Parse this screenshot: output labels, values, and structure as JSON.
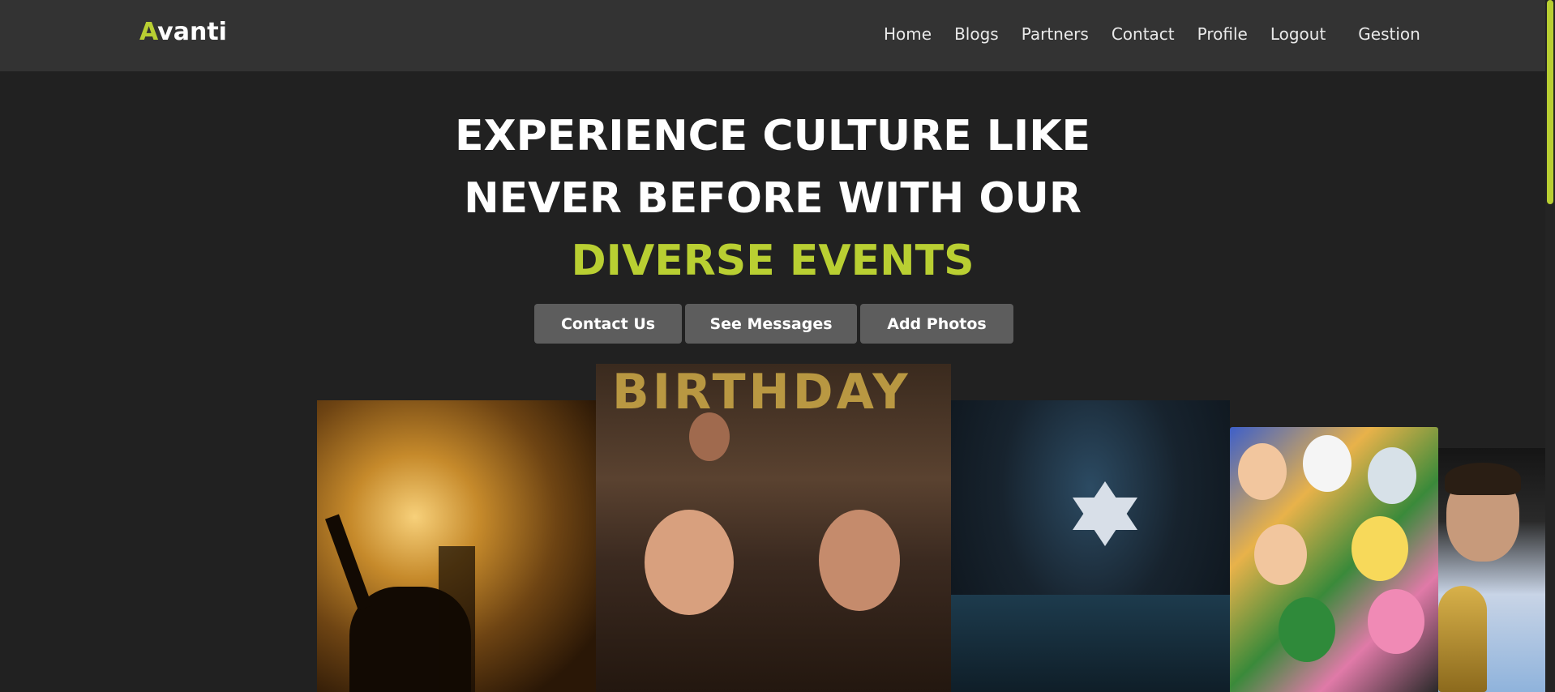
{
  "header": {
    "logo_first": "A",
    "logo_rest": "vanti",
    "nav": {
      "home": "Home",
      "blogs": "Blogs",
      "partners": "Partners",
      "contact": "Contact",
      "profile": "Profile",
      "logout": "Logout",
      "gestion": "Gestion"
    }
  },
  "hero": {
    "line1": "EXPERIENCE CULTURE LIKE",
    "line2": "NEVER BEFORE WITH OUR",
    "line3": "DIVERSE EVENTS"
  },
  "buttons": {
    "contact": "Contact Us",
    "messages": "See Messages",
    "photos": "Add Photos"
  },
  "gallery": {
    "birthday_banner": "BIRTHDAY"
  },
  "colors": {
    "accent": "#b9cf32",
    "background": "#212121",
    "navbar": "#333333",
    "button": "#5d5d5d"
  }
}
